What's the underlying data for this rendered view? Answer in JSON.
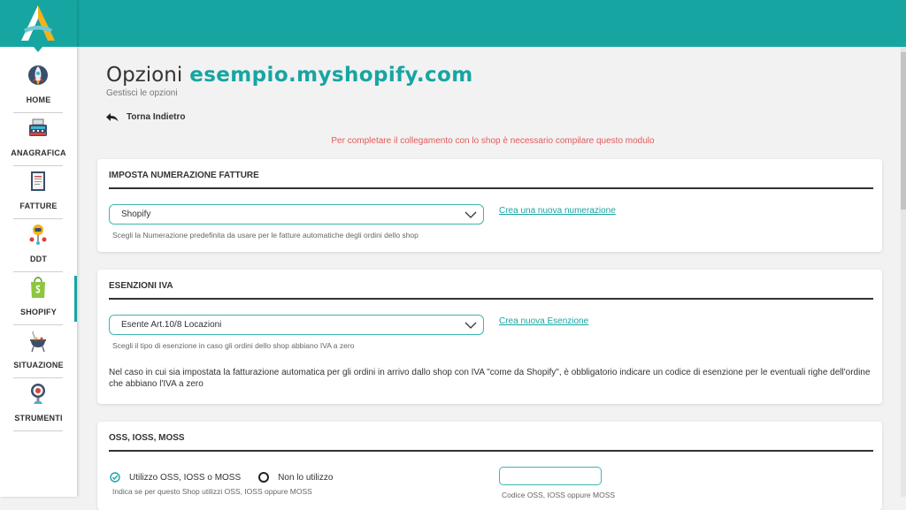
{
  "nav": {
    "items": [
      {
        "label": "HOME",
        "icon": "rocket-icon"
      },
      {
        "label": "ANAGRAFICA",
        "icon": "cash-register-icon"
      },
      {
        "label": "FATTURE",
        "icon": "invoice-icon"
      },
      {
        "label": "DDT",
        "icon": "delivery-note-icon"
      },
      {
        "label": "SHOPIFY",
        "icon": "shopify-bag-icon"
      },
      {
        "label": "SITUAZIONE",
        "icon": "barbecue-icon"
      },
      {
        "label": "STRUMENTI",
        "icon": "tools-icon"
      }
    ],
    "active": "SHOPIFY"
  },
  "header": {
    "title": "Opzioni",
    "shop": "esempio.myshopify.com",
    "subtitle": "Gestisci le opzioni",
    "back_label": "Torna Indietro"
  },
  "alert": "Per completare il collegamento con lo shop è necessario compilare questo modulo",
  "numerazione": {
    "heading": "IMPOSTA NUMERAZIONE FATTURE",
    "selected": "Shopify",
    "help": "Scegli la Numerazione predefinita da usare per le fatture automatiche degli ordini dello shop",
    "link": "Crea una nuova numerazione"
  },
  "esenzioni": {
    "heading": "ESENZIONI IVA",
    "selected": "Esente Art.10/8 Locazioni",
    "help": "Scegli il tipo di esenzione in caso gli ordini dello shop abbiano IVA a zero",
    "link": "Crea nuova Esenzione",
    "note": "Nel caso in cui sia impostata la fatturazione automatica per gli ordini in arrivo dallo shop con IVA \"come da Shopify\", è obbligatorio indicare un codice di esenzione per le eventuali righe dell'ordine che abbiano l'IVA a zero"
  },
  "oss": {
    "heading": "OSS, IOSS, MOSS",
    "option_yes": "Utilizzo OSS, IOSS o MOSS",
    "option_no": "Non lo utilizzo",
    "help": "Indica se per questo Shop utilizzi OSS, IOSS oppure MOSS",
    "code_value": "",
    "code_help": "Codice OSS, IOSS oppure MOSS"
  },
  "colors": {
    "brand": "#17a5a2",
    "alert": "#e35a5a"
  }
}
